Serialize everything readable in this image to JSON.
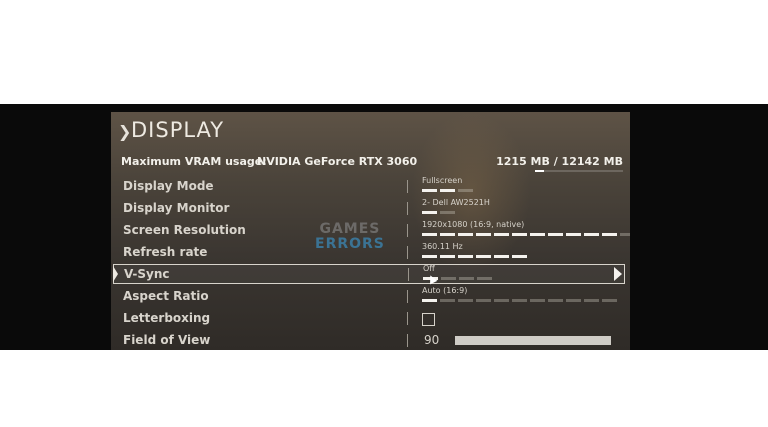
{
  "header": {
    "title": "DISPLAY"
  },
  "vram": {
    "label": "Maximum VRAM usage:",
    "gpu": "NVIDIA GeForce RTX 3060",
    "usage": "1215 MB / 12142 MB",
    "fraction": 0.1
  },
  "settings": [
    {
      "label": "Display Mode",
      "value": "Fullscreen",
      "segments": 3,
      "active": 2
    },
    {
      "label": "Display Monitor",
      "value": "2- Dell AW2521H",
      "segments": 2,
      "active": 1
    },
    {
      "label": "Screen Resolution",
      "value": "1920x1080 (16:9, native)",
      "segments": 12,
      "active": 11
    },
    {
      "label": "Refresh rate",
      "value": "360.11 Hz",
      "segments": 6,
      "active": 6
    },
    {
      "label": "V-Sync",
      "value": "Off",
      "segments": 4,
      "active": 1
    },
    {
      "label": "Aspect Ratio",
      "value": "Auto (16:9)",
      "segments": 11,
      "active": 1
    },
    {
      "label": "Letterboxing",
      "checked": false
    },
    {
      "label": "Field of View",
      "value": "90",
      "slider_fraction": 1.0
    }
  ],
  "watermark": {
    "line1": "GAMES",
    "line2": "ERRORS"
  }
}
